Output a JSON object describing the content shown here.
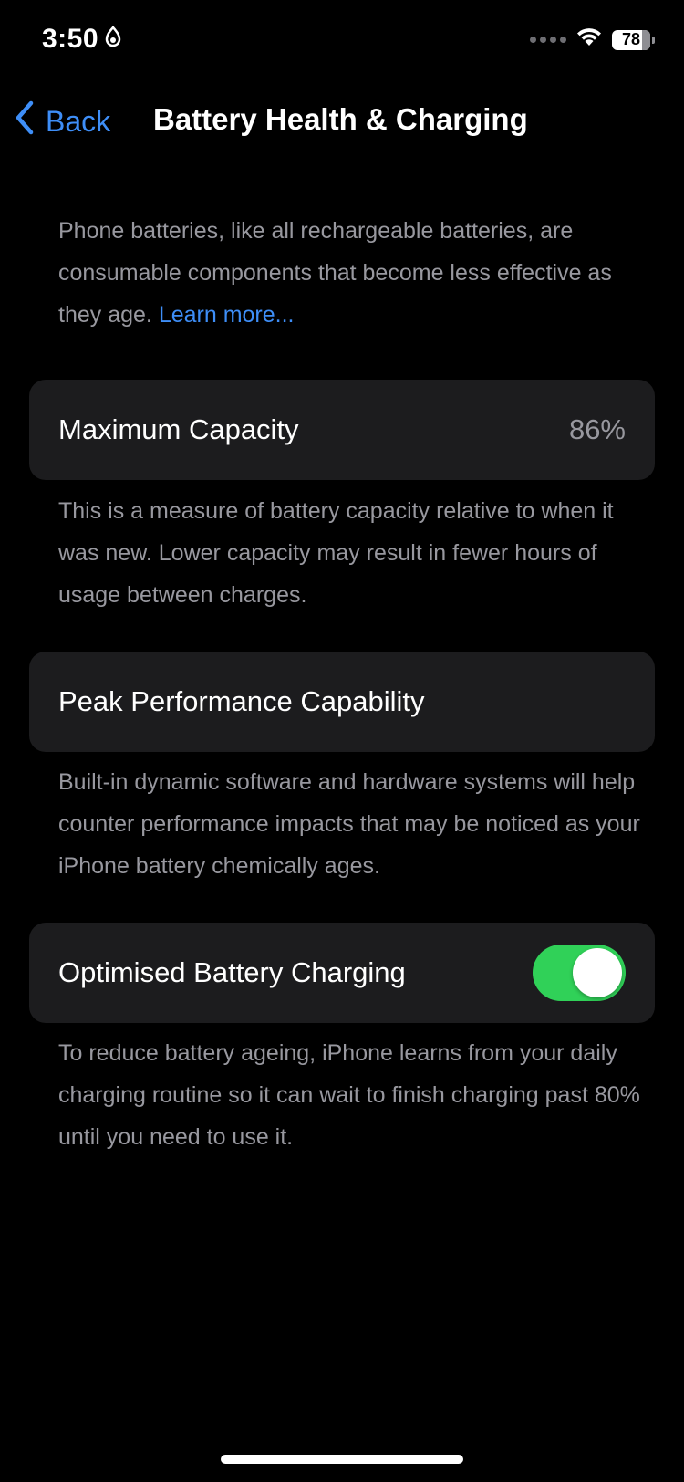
{
  "status_bar": {
    "time": "3:50",
    "battery_level": "78",
    "battery_fraction": 0.78,
    "icons": [
      "focus-icon",
      "signal-dots-icon",
      "wifi-icon",
      "battery-icon"
    ]
  },
  "nav": {
    "back_label": "Back",
    "title": "Battery Health & Charging"
  },
  "intro": {
    "text": "Phone batteries, like all rechargeable batteries, are consumable components that become less effective as they age. ",
    "link": "Learn more..."
  },
  "sections": {
    "max_capacity": {
      "label": "Maximum Capacity",
      "value": "86%",
      "footer": "This is a measure of battery capacity relative to when it was new. Lower capacity may result in fewer hours of usage between charges."
    },
    "peak_performance": {
      "label": "Peak Performance Capability",
      "footer": "Built-in dynamic software and hardware systems will help counter performance impacts that may be noticed as your iPhone battery chemically ages."
    },
    "optimised_charging": {
      "label": "Optimised Battery Charging",
      "enabled": true,
      "footer": "To reduce battery ageing, iPhone learns from your daily charging routine so it can wait to finish charging past 80% until you need to use it."
    }
  },
  "colors": {
    "background": "#000000",
    "cell": "#1c1c1e",
    "accent": "#3e8ef7",
    "toggle_on": "#30d158",
    "secondary_text": "#98989f"
  }
}
